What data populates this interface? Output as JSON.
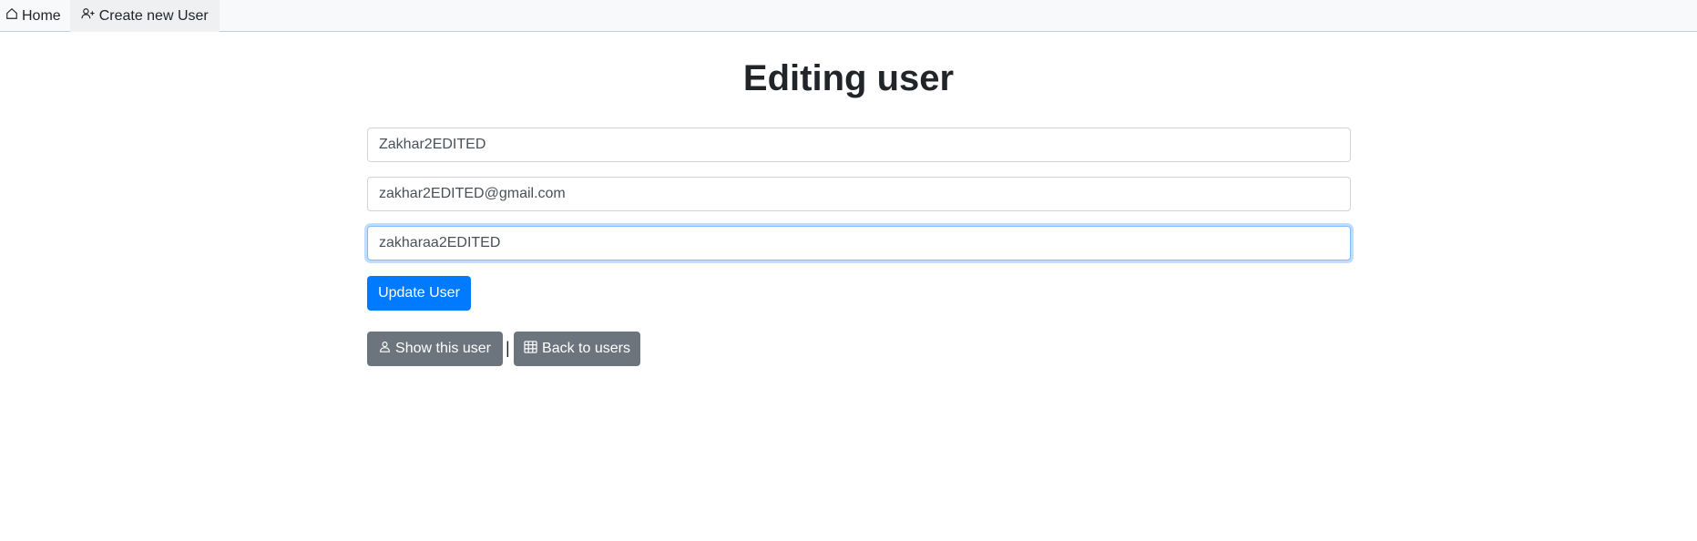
{
  "nav": {
    "home_label": "Home",
    "create_label": "Create new User"
  },
  "page": {
    "title": "Editing user"
  },
  "form": {
    "name_value": "Zakhar2EDITED",
    "email_value": "zakhar2EDITED@gmail.com",
    "password_value": "zakharaa2EDITED",
    "submit_label": "Update User"
  },
  "actions": {
    "show_label": "Show this user",
    "separator": "|",
    "back_label": "Back to users"
  },
  "colors": {
    "primary": "#007bff",
    "secondary": "#6c757d",
    "focus_border": "#80bdff",
    "navbar_bg": "#f8f9fa"
  },
  "icons": {
    "home": "house-icon",
    "create": "person-plus-icon",
    "show": "person-icon",
    "back": "table-icon"
  }
}
